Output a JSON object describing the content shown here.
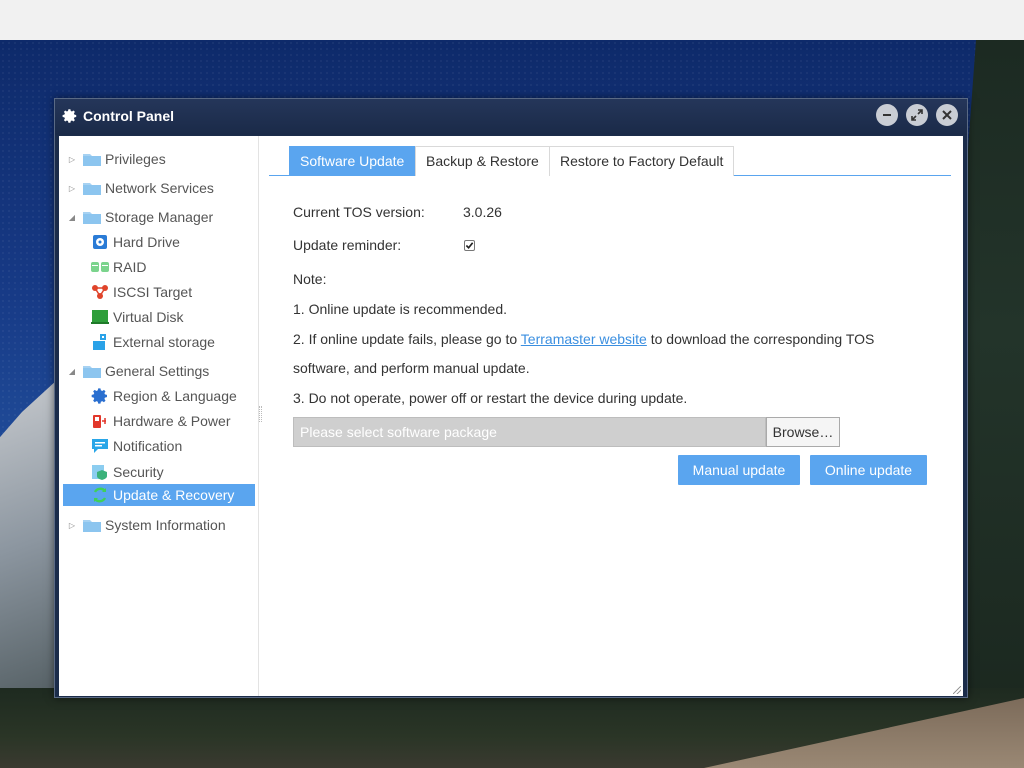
{
  "window": {
    "title": "Control Panel"
  },
  "sidebar": {
    "groups": [
      {
        "label": "Privileges",
        "expanded": false
      },
      {
        "label": "Network Services",
        "expanded": false
      },
      {
        "label": "Storage Manager",
        "expanded": true,
        "children": [
          "Hard Drive",
          "RAID",
          "ISCSI Target",
          "Virtual Disk",
          "External storage"
        ]
      },
      {
        "label": "General Settings",
        "expanded": true,
        "children": [
          "Region & Language",
          "Hardware & Power",
          "Notification",
          "Security",
          "Update & Recovery"
        ]
      },
      {
        "label": "System Information",
        "expanded": false
      }
    ],
    "selected": "Update & Recovery"
  },
  "tabs": [
    {
      "label": "Software Update",
      "active": true
    },
    {
      "label": "Backup & Restore",
      "active": false
    },
    {
      "label": "Restore to Factory Default",
      "active": false
    }
  ],
  "software_update": {
    "current_version_label": "Current TOS version:",
    "current_version_value": "3.0.26",
    "reminder_label": "Update reminder:",
    "reminder_checked": true,
    "note_title": "Note:",
    "note_1": "1. Online update is recommended.",
    "note_2_prefix": "2. If online update fails, please go to ",
    "note_2_link": "Terramaster website",
    "note_2_suffix": " to download the corresponding TOS",
    "note_2_cont": "software, and perform manual update.",
    "note_3": "3. Do not operate, power off or restart the device during update.",
    "file_placeholder": "Please select software package",
    "browse_label": "Browse…",
    "manual_update_label": "Manual update",
    "online_update_label": "Online update"
  },
  "colors": {
    "accent": "#5aa5ef",
    "titlebar": "#1a2a48",
    "link": "#3b8fe0"
  }
}
